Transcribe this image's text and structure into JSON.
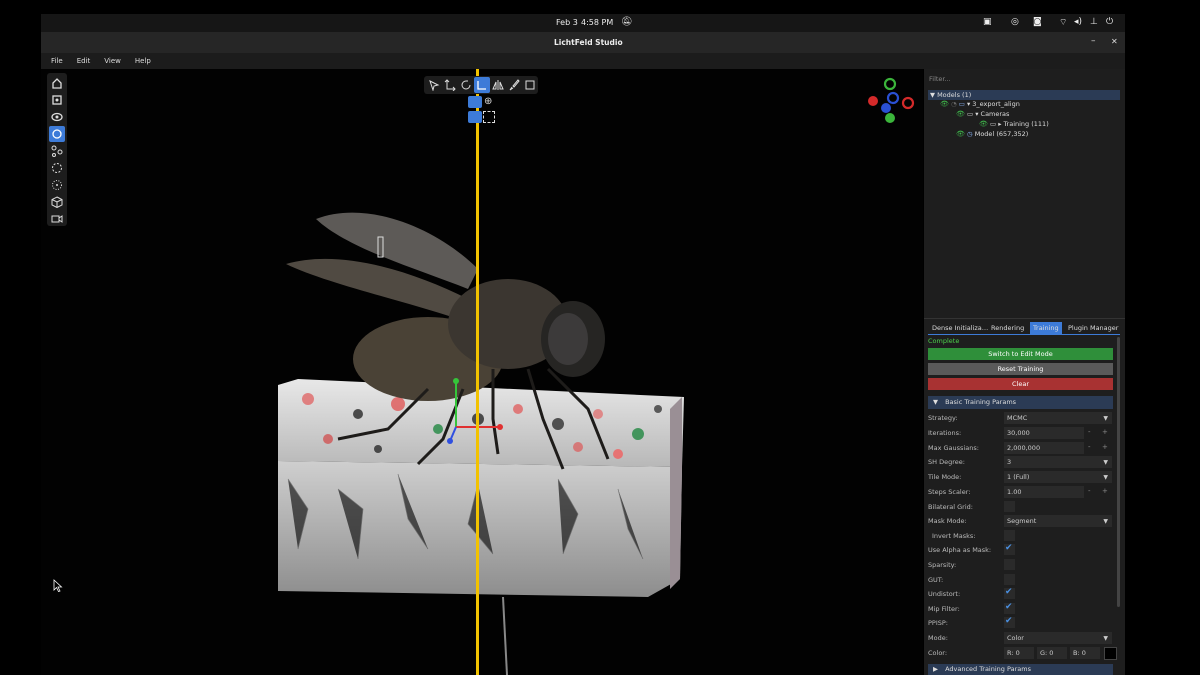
{
  "topbar": {
    "date": "Feb 3",
    "time": "4:58 PM"
  },
  "window": {
    "title": "LichtFeld Studio",
    "minimize": "–",
    "close": "✕"
  },
  "menu": [
    "File",
    "Edit",
    "View",
    "Help"
  ],
  "left_toolbar_icons": [
    "home-icon",
    "frame-icon",
    "eye-icon",
    "scene-icon",
    "nodes-icon",
    "circle-select-icon",
    "dotted-circle-icon",
    "cube-icon",
    "camera-icon"
  ],
  "top_toolbar_icons": [
    "select-icon",
    "translate-icon",
    "rotate-icon",
    "scale-icon",
    "mirror-icon",
    "brush-icon",
    "crop-icon"
  ],
  "right_panel": {
    "filter_placeholder": "Filter...",
    "tree": {
      "models": "Models (1)",
      "export": "3_export_align",
      "cameras": "Cameras",
      "training": "Training (111)",
      "model": "Model",
      "model_count": "(657,352)"
    },
    "tabs": [
      "Dense Initializa…",
      "Rendering",
      "Training",
      "Plugin Manager"
    ],
    "status": "Complete",
    "buttons": {
      "switch": "Switch to Edit Mode",
      "reset": "Reset Training",
      "clear": "Clear"
    },
    "section_basic": "Basic Training Params",
    "section_advanced": "Advanced Training Params",
    "params": {
      "strategy_label": "Strategy:",
      "strategy": "MCMC",
      "iterations_label": "Iterations:",
      "iterations": "30,000",
      "maxg_label": "Max Gaussians:",
      "maxg": "2,000,000",
      "sh_label": "SH Degree:",
      "sh": "3",
      "tile_label": "Tile Mode:",
      "tile": "1 (Full)",
      "steps_label": "Steps Scaler:",
      "steps": "1.00",
      "bilateral_label": "Bilateral Grid:",
      "mask_label": "Mask Mode:",
      "mask": "Segment",
      "invert_label": "Invert Masks:",
      "alpha_label": "Use Alpha as Mask:",
      "sparsity_label": "Sparsity:",
      "gut_label": "GUT:",
      "undistort_label": "Undistort:",
      "mip_label": "Mip Filter:",
      "ppisp_label": "PPISP:",
      "mode_label": "Mode:",
      "mode": "Color",
      "color_label": "Color:",
      "r": "R: 0",
      "g": "G: 0",
      "b": "B: 0"
    }
  },
  "colors": {
    "accent": "#3d7bd8",
    "green_btn": "#2f8f3a",
    "red_btn": "#a83232",
    "split_line": "#f2c200"
  }
}
